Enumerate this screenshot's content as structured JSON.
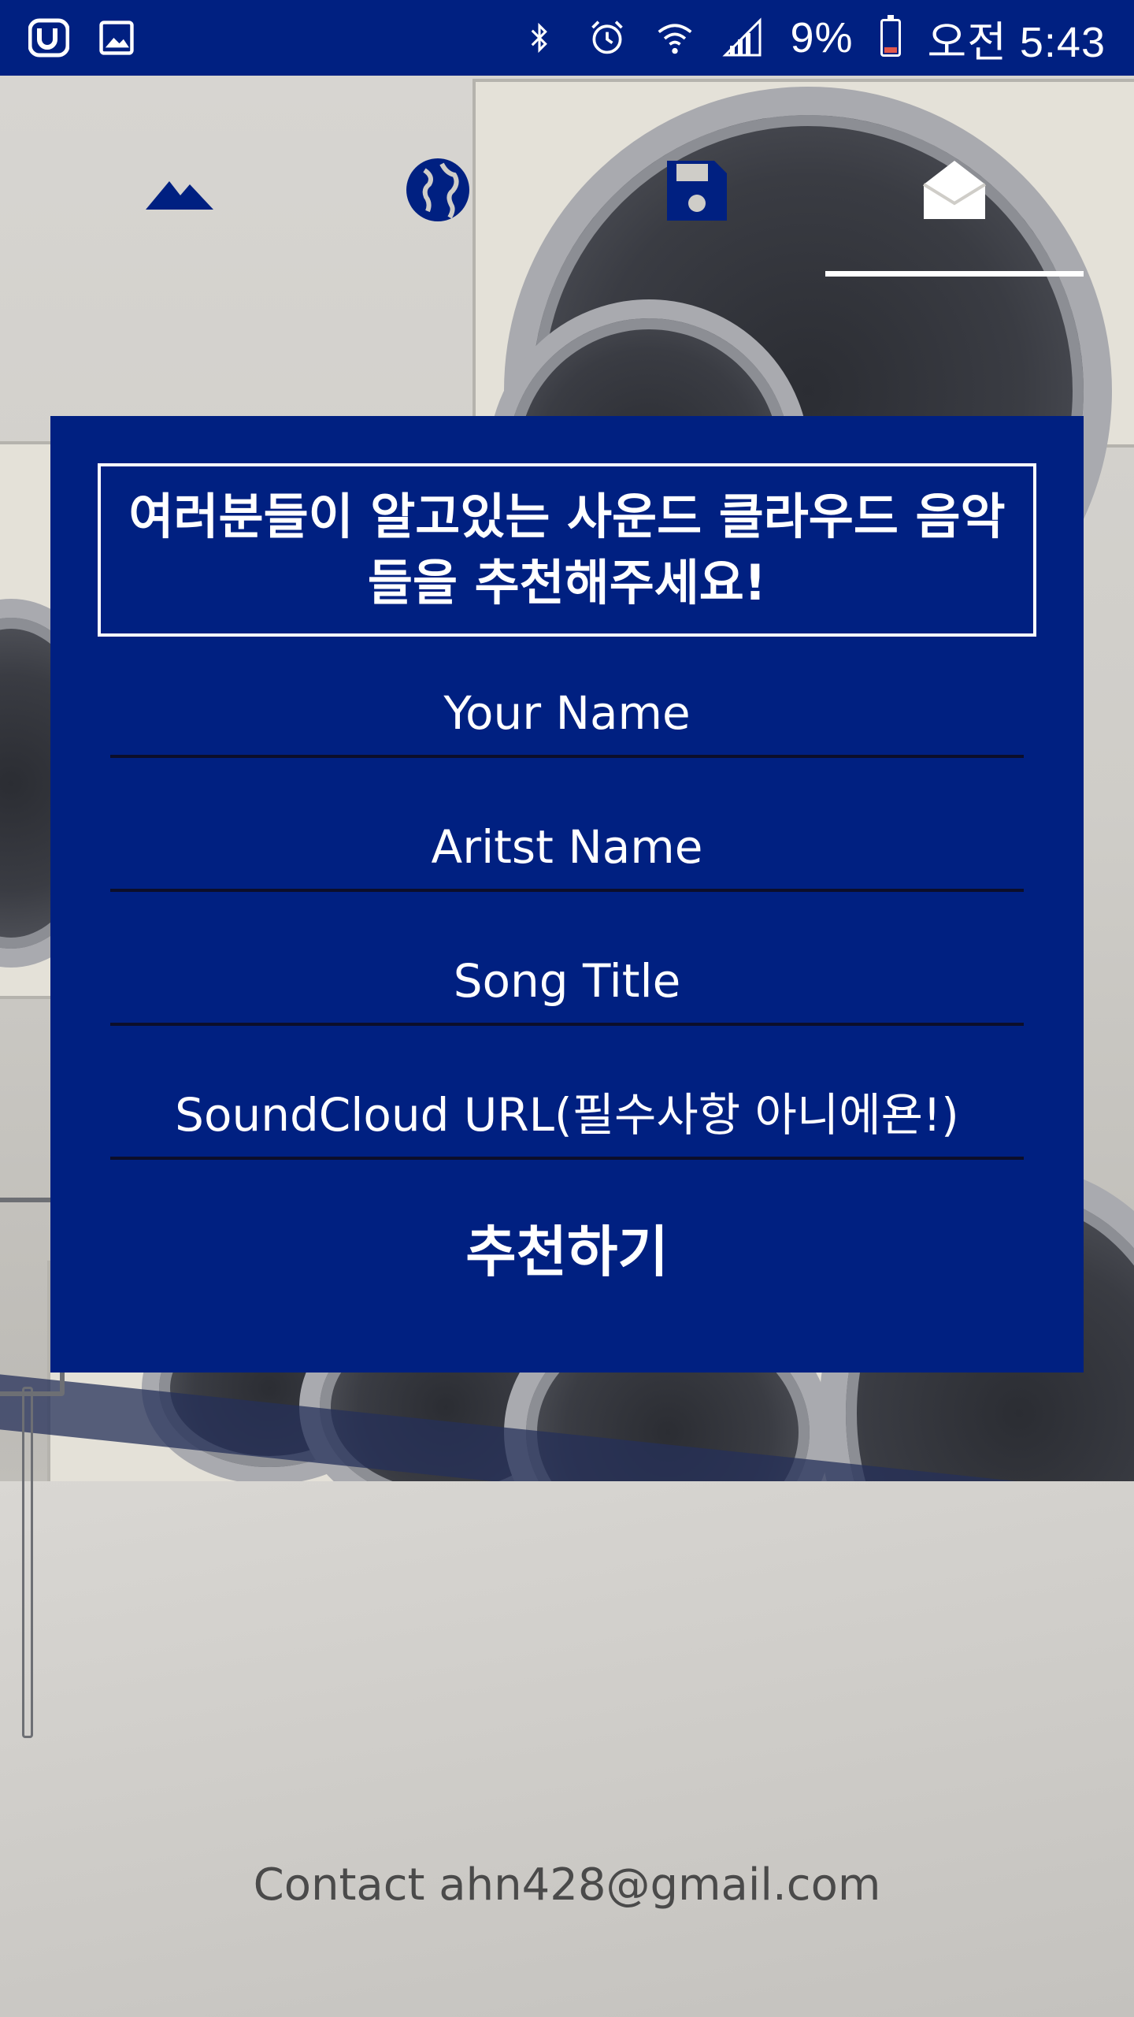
{
  "status_bar": {
    "icons": [
      "u-plus-icon",
      "gallery-icon",
      "bluetooth-icon",
      "alarm-icon",
      "wifi-icon",
      "signal-icon",
      "battery-icon"
    ],
    "battery": "9%",
    "time": "오전 5:43"
  },
  "tabs": [
    {
      "name": "mountain-icon"
    },
    {
      "name": "globe-icon"
    },
    {
      "name": "floppy-disk-icon"
    },
    {
      "name": "open-envelope-icon",
      "selected": true
    }
  ],
  "form": {
    "title": "여러분들이 알고있는 사운드 클라우드 음악들을 추천해주세요!",
    "fields": [
      {
        "placeholder": "Your Name"
      },
      {
        "placeholder": "Aritst Name"
      },
      {
        "placeholder": "Song Title"
      },
      {
        "placeholder": "SoundCloud URL(필수사항 아니에욘!)"
      }
    ],
    "submit_label": "추천하기"
  },
  "footer": {
    "contact": "Contact ahn428@gmail.com"
  },
  "colors": {
    "brand_blue": "#002081",
    "text": "#ffffff",
    "footer_text": "#4a4a4a"
  }
}
